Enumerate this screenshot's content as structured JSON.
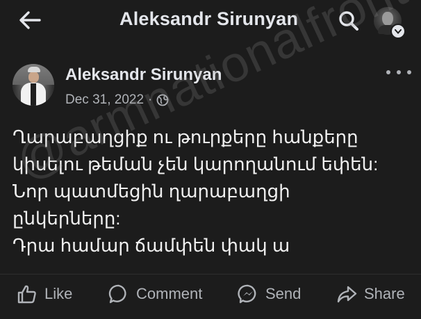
{
  "topbar": {
    "title": "Aleksandr Sirunyan",
    "back_icon": "arrow-left-icon",
    "search_icon": "search-icon"
  },
  "post": {
    "author": "Aleksandr Sirunyan",
    "date": "Dec 31, 2022",
    "separator": "·",
    "audience_icon": "globe-icon",
    "more_icon": "more-horizontal-icon",
    "text_lines": [
      "Ղարաբաղցիք ու թուրքերը հանքերը",
      "կիսելու թեման չեն կարողանում եփեն:",
      "Նոր պատմեցին ղարաբաղցի",
      "ընկերները:",
      "Դրա համար ճամփեն փակ ա"
    ]
  },
  "actions": {
    "like": "Like",
    "comment": "Comment",
    "send": "Send",
    "share": "Share"
  },
  "watermark": "@armnationalfront",
  "colors": {
    "background": "#1c1c1c",
    "text_primary": "#e4e6eb",
    "text_secondary": "#b0b3b8"
  }
}
